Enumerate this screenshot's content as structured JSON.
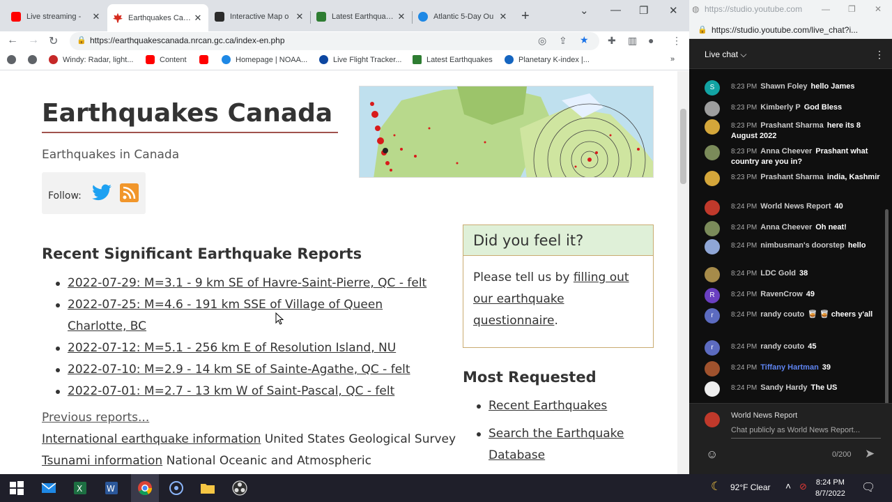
{
  "browser": {
    "tabs": [
      {
        "title": "Live streaming -",
        "favicon_color": "#ff0000"
      },
      {
        "title": "Earthquakes Canada",
        "favicon_color": "#d52b1e"
      },
      {
        "title": "Interactive Map o",
        "favicon_color": "#2b2b2b"
      },
      {
        "title": "Latest Earthquakes",
        "favicon_color": "#2e7d32"
      },
      {
        "title": "Atlantic 5-Day Ou",
        "favicon_color": "#1e88e5"
      }
    ],
    "url": "https://earthquakescanada.nrcan.gc.ca/index-en.php",
    "bookmarks": [
      {
        "label": "Windy: Radar, light...",
        "color": "#c62828"
      },
      {
        "label": "Content",
        "color": "#ff0000"
      },
      {
        "label": "",
        "color": "#ff0000"
      },
      {
        "label": "Homepage | NOAA...",
        "color": "#1e88e5"
      },
      {
        "label": "Live Flight Tracker...",
        "color": "#0d47a1"
      },
      {
        "label": "Latest Earthquakes",
        "color": "#2e7d32"
      },
      {
        "label": "Planetary K-index |...",
        "color": "#1565c0"
      }
    ]
  },
  "page": {
    "title": "Earthquakes Canada",
    "subtitle": "Earthquakes in Canada",
    "follow_label": "Follow:",
    "recent_heading": "Recent Significant Earthquake Reports",
    "reports": [
      "2022-07-29: M=3.1 - 9 km SE of Havre-Saint-Pierre, QC - felt",
      "2022-07-25: M=4.6 - 191 km SSE of Village of Queen Charlotte, BC",
      "2022-07-12: M=5.1 - 256 km E of Resolution Island, NU",
      "2022-07-10: M=2.9 - 14 km SE of Sainte-Agathe, QC - felt",
      "2022-07-01: M=2.7 - 13 km W of Saint-Pascal, QC - felt"
    ],
    "previous_reports": "Previous reports...",
    "intl_link": "International earthquake information",
    "intl_text": "United States Geological Survey",
    "tsunami_link": "Tsunami information",
    "tsunami_text": "National Oceanic and Atmospheric",
    "feel": {
      "title": "Did you feel it?",
      "text_before": "Please tell us by ",
      "link": "filling out our earthquake questionnaire",
      "text_after": "."
    },
    "most_heading": "Most Requested",
    "most": [
      "Recent Earthquakes",
      "Search the Earthquake Database"
    ]
  },
  "chat": {
    "url_short": "https://studio.youtube.com",
    "url": "https://studio.youtube.com/live_chat?i...",
    "header": "Live chat",
    "messages": [
      {
        "time": "8:23 PM",
        "author": "Shawn Foley",
        "text": "hello James",
        "avatar": "S",
        "color": "#12a3a3",
        "member": false
      },
      {
        "time": "8:23 PM",
        "author": "Kimberly P",
        "text": "God Bless",
        "avatar": "",
        "color": "#9e9e9e",
        "member": false
      },
      {
        "time": "8:23 PM",
        "author": "Prashant Sharma",
        "text": "here its 8 August 2022",
        "avatar": "",
        "color": "#d4a63a",
        "member": false
      },
      {
        "time": "8:23 PM",
        "author": "Anna Cheever",
        "text": "Prashant what country are you in?",
        "avatar": "",
        "color": "#7b8b5a",
        "member": false
      },
      {
        "time": "8:23 PM",
        "author": "Prashant Sharma",
        "text": "india, Kashmir",
        "avatar": "",
        "color": "#d4a63a",
        "member": false
      },
      {
        "time": "8:24 PM",
        "author": "World News Report",
        "text": "40",
        "avatar": "",
        "color": "#c0392b",
        "member": false
      },
      {
        "time": "8:24 PM",
        "author": "Anna Cheever",
        "text": "Oh neat!",
        "avatar": "",
        "color": "#7b8b5a",
        "member": false
      },
      {
        "time": "8:24 PM",
        "author": "nimbusman's doorstep",
        "text": "hello",
        "avatar": "",
        "color": "#8fa6d6",
        "member": false
      },
      {
        "time": "8:24 PM",
        "author": "LDC Gold",
        "text": "38",
        "avatar": "",
        "color": "#a68b4a",
        "member": false
      },
      {
        "time": "8:24 PM",
        "author": "RavenCrow",
        "text": "49",
        "avatar": "R",
        "color": "#6a3fc1",
        "member": false
      },
      {
        "time": "8:24 PM",
        "author": "randy couto",
        "text": "🥃 🥃 cheers y'all",
        "avatar": "r",
        "color": "#5c6bc0",
        "member": false
      },
      {
        "time": "8:24 PM",
        "author": "randy couto",
        "text": "45",
        "avatar": "r",
        "color": "#5c6bc0",
        "member": false
      },
      {
        "time": "8:24 PM",
        "author": "Tiffany Hartman",
        "text": "39",
        "avatar": "",
        "color": "#a0522d",
        "member": true
      },
      {
        "time": "8:24 PM",
        "author": "Sandy Hardy",
        "text": "The US",
        "avatar": "",
        "color": "#eeeeee",
        "member": false
      }
    ],
    "footer_user": "World News Report",
    "footer_placeholder": "Chat publicly as World News Report...",
    "char_count": "0/200"
  },
  "taskbar": {
    "weather": "92°F  Clear",
    "time": "8:24 PM",
    "date": "8/7/2022"
  }
}
